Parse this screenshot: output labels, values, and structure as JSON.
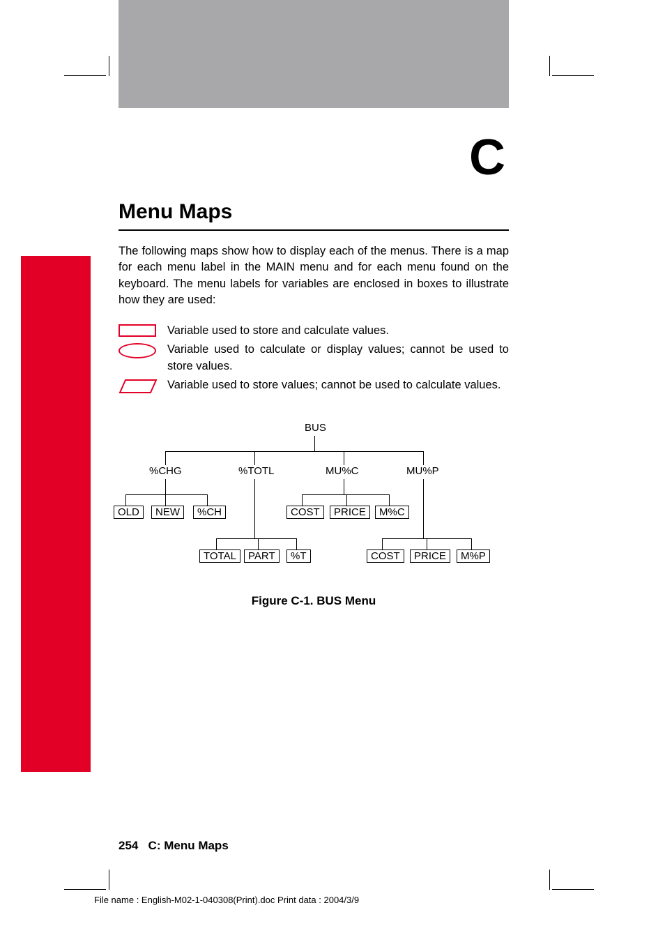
{
  "appendix_letter": "C",
  "title": "Menu Maps",
  "paragraph": "The following maps show how to display each of the menus. There is a map for each menu label in the MAIN menu and for each menu found on the keyboard. The menu labels for variables are enclosed in boxes to illustrate how they are used:",
  "legend": {
    "store_calc": "Variable used to store and calculate values.",
    "calc_display": "Variable used to calculate or display values; cannot be used to store values.",
    "store_only": "Variable used to store values; cannot be used to calculate values."
  },
  "figure_caption": "Figure C-1. BUS Menu",
  "footer": {
    "page": "254",
    "section": "C: Menu Maps"
  },
  "file_info": "File name : English-M02-1-040308(Print).doc    Print data : 2004/3/9",
  "chart_data": {
    "type": "diagram",
    "title": "BUS Menu",
    "root": "BUS",
    "children": [
      {
        "label": "%CHG",
        "children": [
          "OLD",
          "NEW",
          "%CH"
        ],
        "children_boxed": true
      },
      {
        "label": "%TOTL",
        "children": [
          "TOTAL",
          "PART",
          "%T"
        ],
        "children_boxed": true
      },
      {
        "label": "MU%C",
        "children": [
          "COST",
          "PRICE",
          "M%C"
        ],
        "children_boxed": true
      },
      {
        "label": "MU%P",
        "children": [
          "COST",
          "PRICE",
          "M%P"
        ],
        "children_boxed": true
      }
    ]
  }
}
